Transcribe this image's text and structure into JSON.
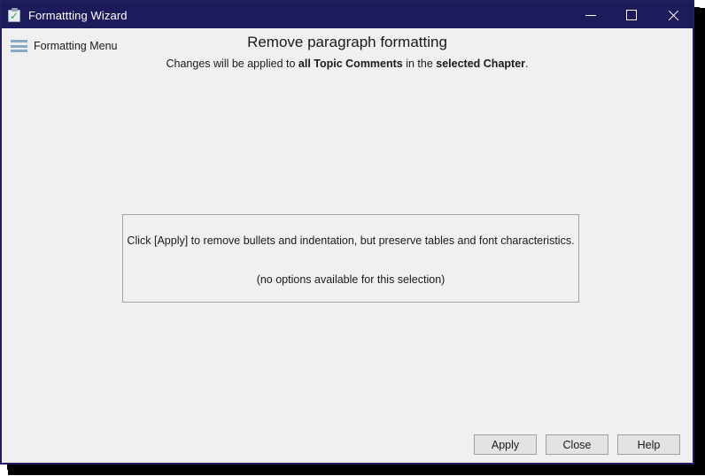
{
  "window": {
    "title": "Formattting Wizard",
    "icon": "clipboard-check-icon",
    "titlebar_color": "#1e1b5c",
    "border_color": "#231f5e",
    "background_color": "#f0f0f0",
    "controls": {
      "minimize": "minimize-icon",
      "maximize": "maximize-icon",
      "close": "close-icon"
    }
  },
  "menu": {
    "icon": "hamburger-icon",
    "label": "Formatting Menu",
    "icon_color": "#8aa7c6"
  },
  "page": {
    "heading": "Remove paragraph formatting",
    "subheading": {
      "part1": "Changes will be applied to ",
      "bold1": "all Topic Comments",
      "part2": " in the ",
      "bold2": "selected Chapter",
      "part3": "."
    }
  },
  "options_panel": {
    "line1": "Click [Apply] to remove bullets and indentation, but preserve tables and font characteristics.",
    "line2": "(no options available for this selection)",
    "border_color": "#a6a6a6"
  },
  "footer": {
    "apply_label": "Apply",
    "close_label": "Close",
    "help_label": "Help"
  }
}
